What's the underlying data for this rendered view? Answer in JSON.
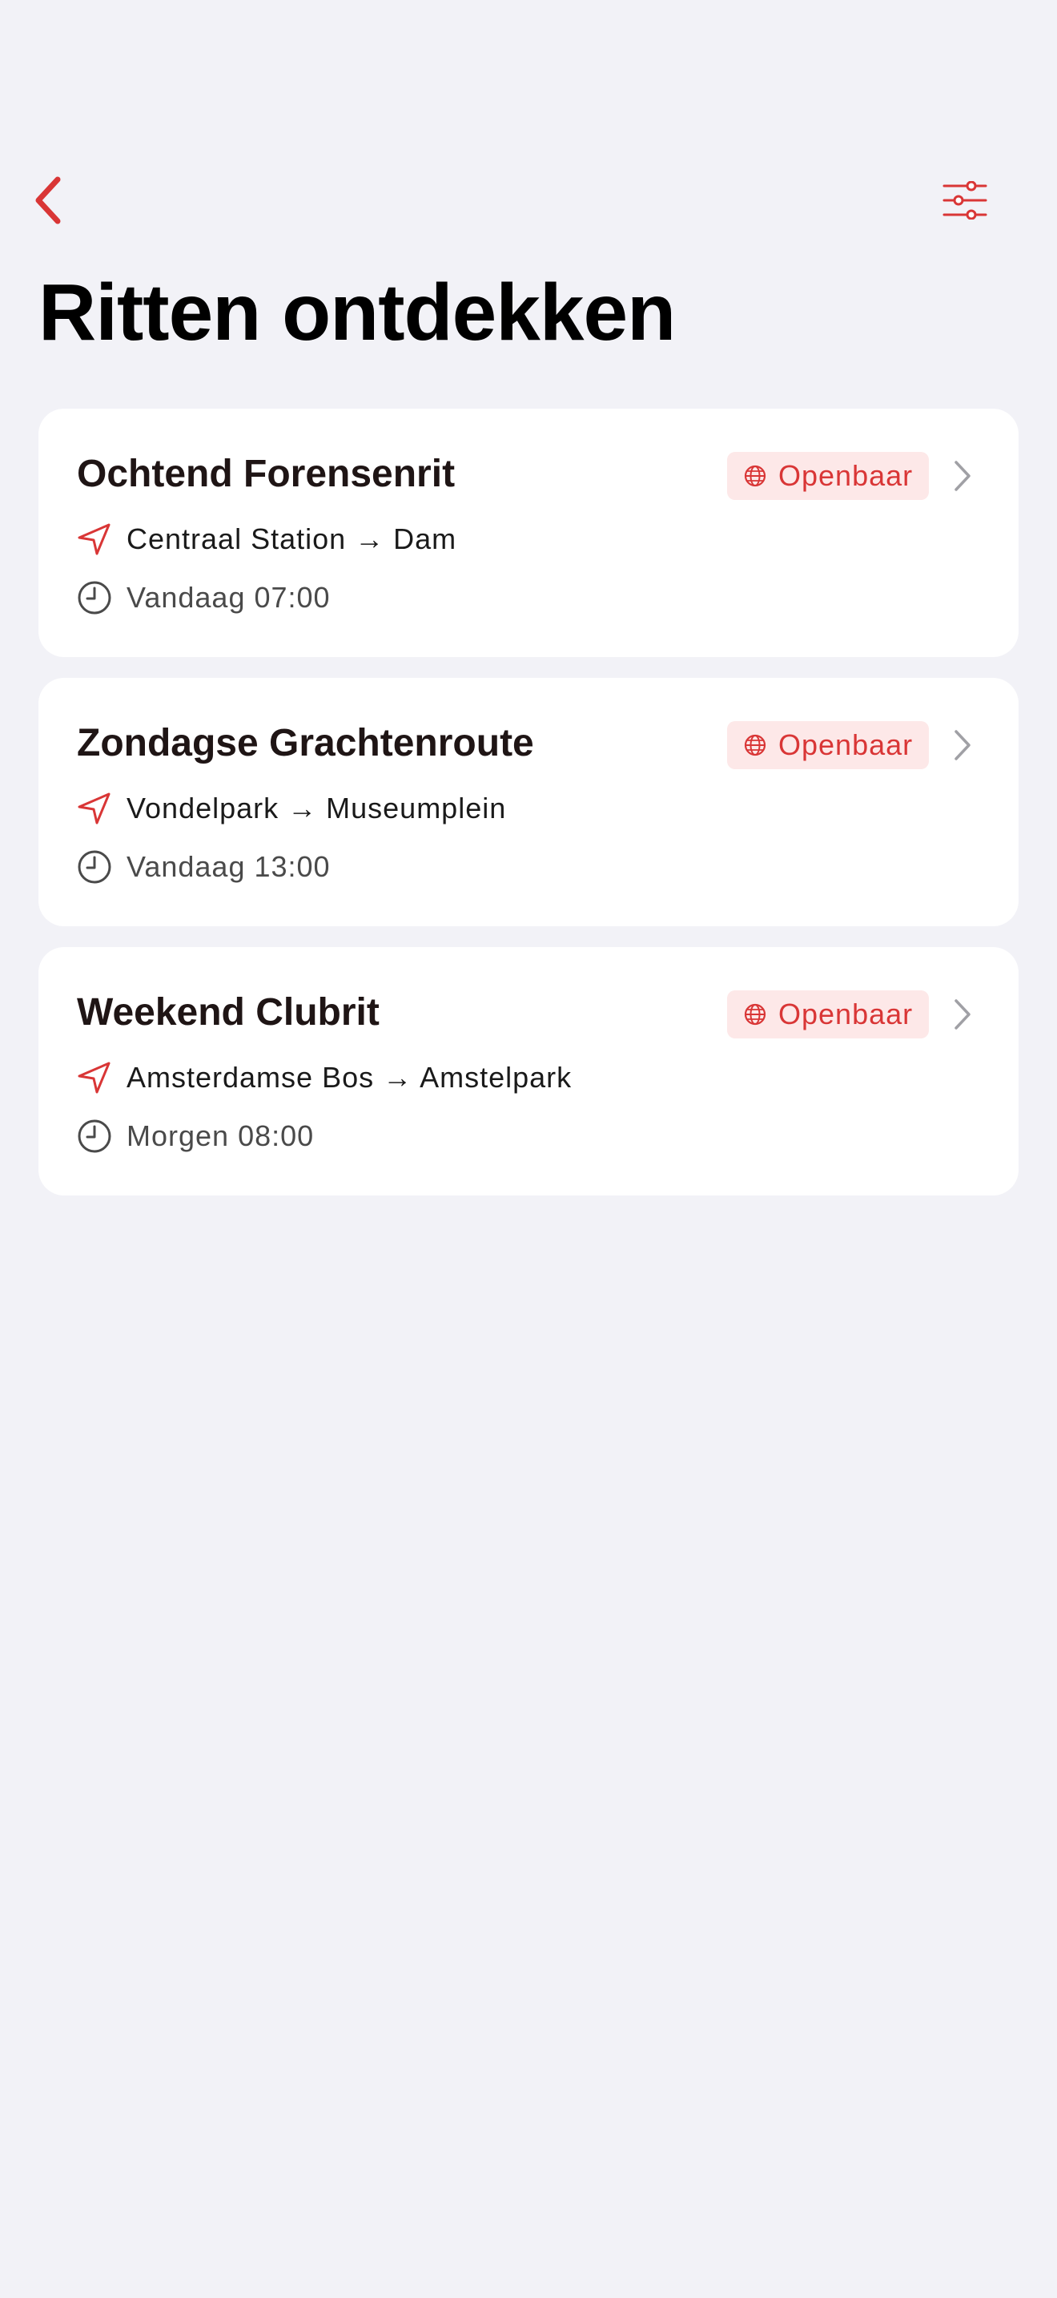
{
  "header": {
    "title": "Ritten ontdekken",
    "back_icon": "chevron-left-icon",
    "filter_icon": "sliders-icon"
  },
  "colors": {
    "accent": "#d93636",
    "badge_bg": "#fde8e8",
    "background": "#f2f2f7",
    "card": "#ffffff"
  },
  "rides": [
    {
      "title": "Ochtend Forensenrit",
      "badge": "Openbaar",
      "route": "Centraal Station → Dam",
      "time": "Vandaag 07:00"
    },
    {
      "title": "Zondagse Grachtenroute",
      "badge": "Openbaar",
      "route": "Vondelpark → Museumplein",
      "time": "Vandaag 13:00"
    },
    {
      "title": "Weekend Clubrit",
      "badge": "Openbaar",
      "route": "Amsterdamse Bos → Amstelpark",
      "time": "Morgen 08:00"
    }
  ]
}
